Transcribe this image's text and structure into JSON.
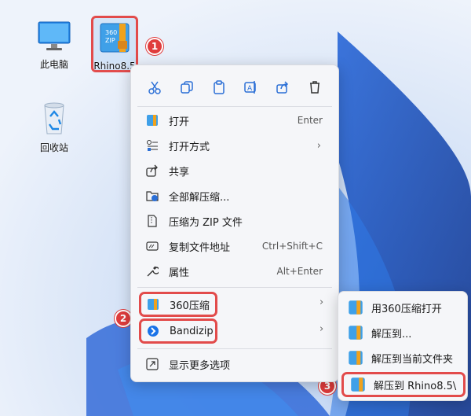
{
  "desktop": {
    "icons": [
      {
        "label": "此电脑"
      },
      {
        "label": "Rhino8.5"
      },
      {
        "label": "回收站"
      }
    ]
  },
  "context_menu": {
    "toolbar": [
      "cut-icon",
      "copy-icon",
      "paste-icon",
      "rename-icon",
      "share-icon",
      "delete-icon"
    ],
    "items": [
      {
        "label": "打开",
        "shortcut": "Enter"
      },
      {
        "label": "打开方式",
        "arrow": "›"
      },
      {
        "label": "共享"
      },
      {
        "label": "全部解压缩..."
      },
      {
        "label": "压缩为 ZIP 文件"
      },
      {
        "label": "复制文件地址",
        "shortcut": "Ctrl+Shift+C"
      },
      {
        "label": "属性",
        "shortcut": "Alt+Enter"
      },
      {
        "label": "360压缩",
        "arrow": "›"
      },
      {
        "label": "Bandizip",
        "arrow": "›"
      },
      {
        "label": "显示更多选项"
      }
    ]
  },
  "submenu": {
    "items": [
      {
        "label": "用360压缩打开"
      },
      {
        "label": "解压到..."
      },
      {
        "label": "解压到当前文件夹"
      },
      {
        "label": "解压到 Rhino8.5\\"
      }
    ]
  },
  "badges": [
    "1",
    "2",
    "3"
  ],
  "colors": {
    "highlight": "#e24b4b",
    "accent": "#1a73e8",
    "menu_bg": "#f5f6f9"
  }
}
